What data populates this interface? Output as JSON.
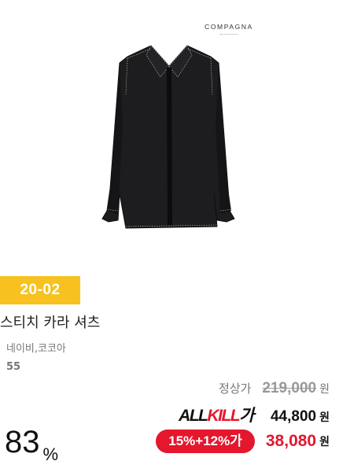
{
  "product": {
    "brand": "COMPAGNA",
    "image_alt": "black stitch collar shirt",
    "tag": "20-02",
    "name": "스티치 카라 셔츠",
    "colors": "네이비,코코아",
    "size": "55"
  },
  "pricing": {
    "regular_label": "정상가",
    "regular_price": "219,000",
    "currency": "원",
    "allkill_label_main": "ALL",
    "allkill_label_red": "KILL",
    "allkill_label_suffix": "가",
    "allkill_price": "44,800",
    "promo_badge": "15%+12%가",
    "final_price": "38,080",
    "discount_value": "83",
    "discount_unit": "%"
  },
  "colors": {
    "tag_bg": "#f7c21f",
    "accent_red": "#e4172d"
  }
}
